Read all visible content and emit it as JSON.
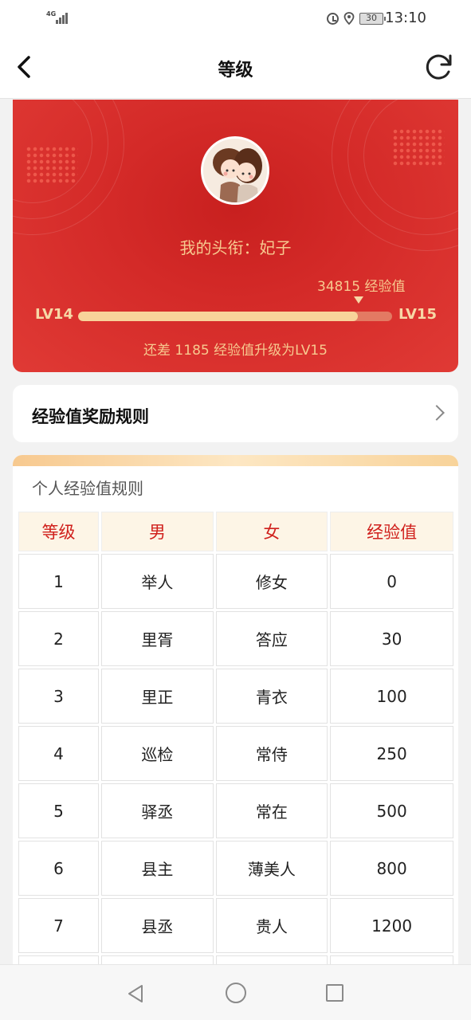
{
  "status_bar": {
    "network": "4G",
    "battery": "30",
    "time": "13:10",
    "icons": [
      "signal-icon",
      "alarm-icon",
      "location-icon",
      "battery-icon"
    ]
  },
  "header": {
    "title": "等级",
    "back_icon": "back-arrow-icon",
    "refresh_icon": "refresh-icon"
  },
  "level_card": {
    "title_text": "我的头衔：妃子",
    "exp_label": "34815 经验值",
    "current_level": "LV14",
    "next_level": "LV15",
    "progress_fraction": 0.89,
    "hint": "还差 1185 经验值升级为LV15",
    "colors": {
      "card": "#d42a28",
      "accent": "#f7c98f",
      "bar_fill": "#f8d39a"
    }
  },
  "rules_row": {
    "label": "经验值奖励规则",
    "icon": "chevron-right-icon"
  },
  "table": {
    "title": "个人经验值规则",
    "headers": [
      "等级",
      "男",
      "女",
      "经验值"
    ],
    "rows": [
      [
        "1",
        "举人",
        "修女",
        "0"
      ],
      [
        "2",
        "里胥",
        "答应",
        "30"
      ],
      [
        "3",
        "里正",
        "青衣",
        "100"
      ],
      [
        "4",
        "巡检",
        "常侍",
        "250"
      ],
      [
        "5",
        "驿丞",
        "常在",
        "500"
      ],
      [
        "6",
        "县主",
        "薄美人",
        "800"
      ],
      [
        "7",
        "县丞",
        "贵人",
        "1200"
      ]
    ]
  },
  "nav_bar": {
    "icons": [
      "nav-back-icon",
      "nav-home-icon",
      "nav-recent-icon"
    ]
  }
}
